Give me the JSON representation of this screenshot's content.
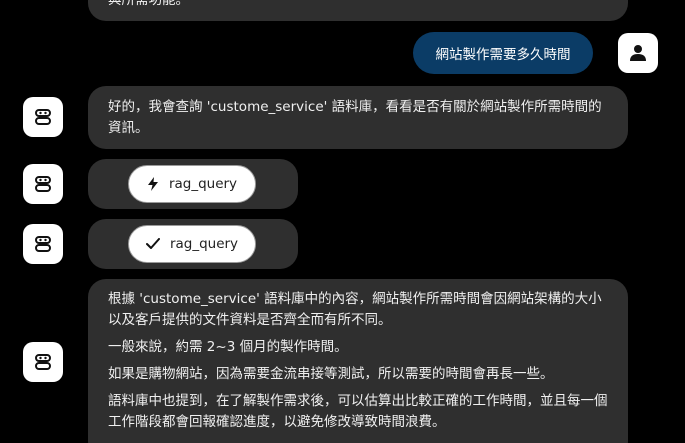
{
  "colors": {
    "background": "#000000",
    "bot_bubble": "#2f2f2f",
    "user_bubble": "#0b3c66",
    "avatar_bg": "#ffffff"
  },
  "messages": {
    "top_partial": "與所需功能。",
    "user_question": "網站製作需要多久時間",
    "bot_intro": "好的，我會查詢 'custome_service' 語料庫，看看是否有關於網站製作所需時間的資訊。",
    "tool_running": {
      "icon": "bolt-icon",
      "label": "rag_query"
    },
    "tool_done": {
      "icon": "check-icon",
      "label": "rag_query"
    },
    "answer": {
      "p1": "根據 'custome_service' 語料庫中的內容，網站製作所需時間會因網站架構的大小以及客戶提供的文件資料是否齊全而有所不同。",
      "p2": "一般來說，約需 2~3 個月的製作時間。",
      "p3": "如果是購物網站，因為需要金流串接等測試，所以需要的時間會再長一些。",
      "p4": "語料庫中也提到，在了解製作需求後，可以估算出比較正確的工作時間，並且每一個工作階段都會回報確認進度，以避免修改導致時間浪費。"
    }
  },
  "icons": {
    "user_avatar": "person-icon",
    "bot_avatar": "robot-icon"
  }
}
